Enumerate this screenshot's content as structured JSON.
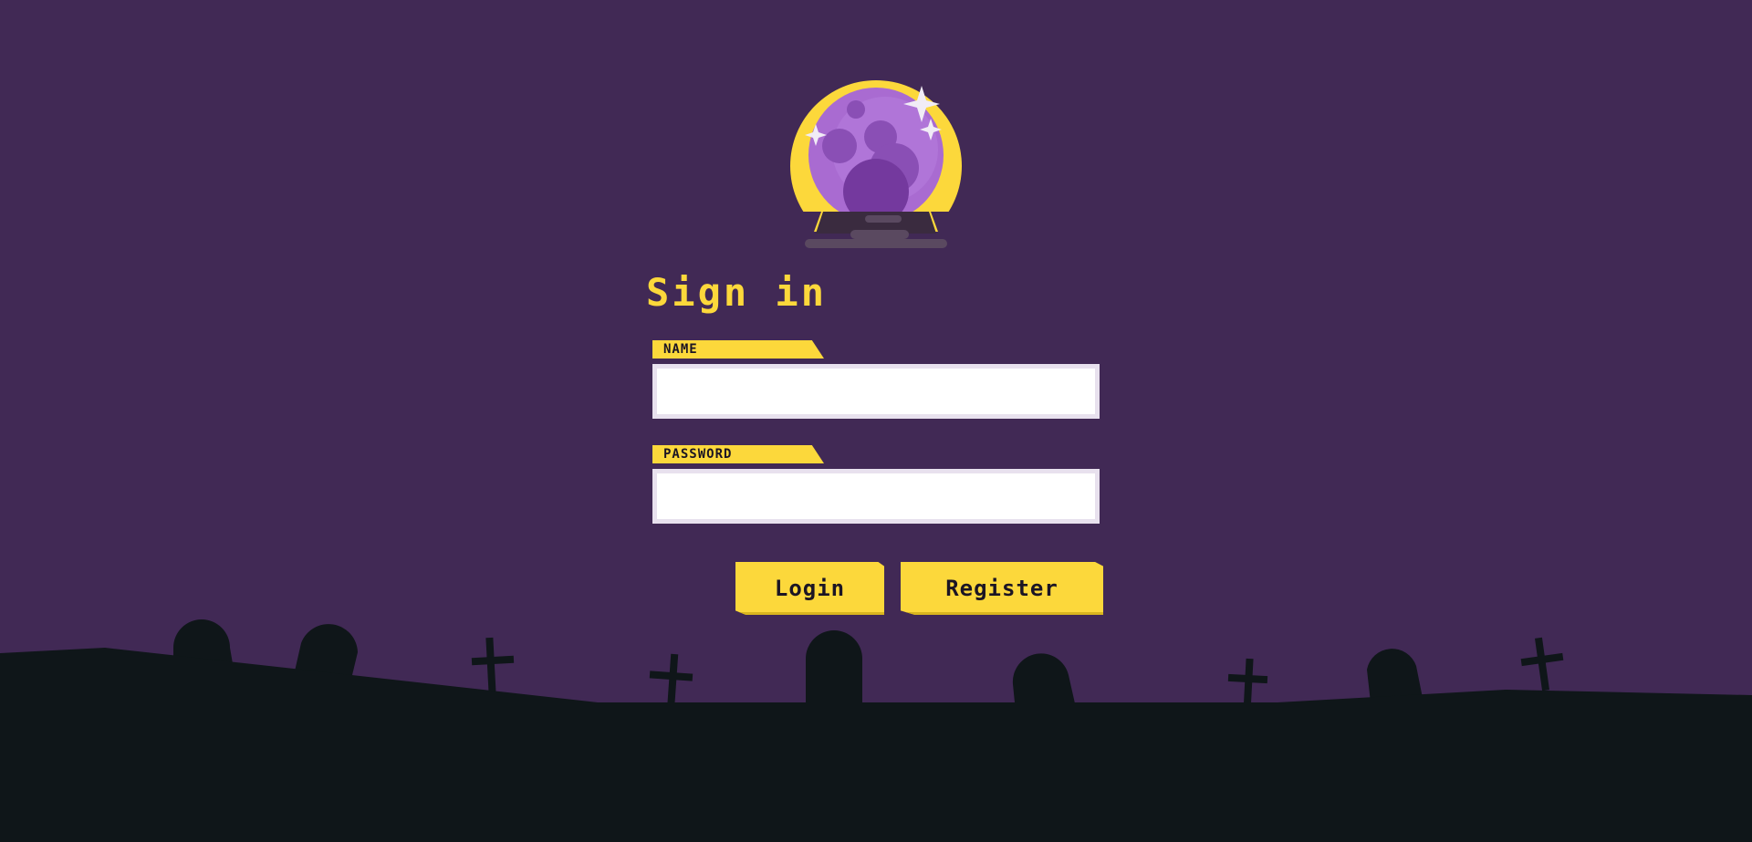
{
  "page": {
    "title": "Sign in"
  },
  "logo": {
    "icon": "crystal-ball-icon"
  },
  "form": {
    "name_label": "NAME",
    "name_value": "",
    "password_label": "PASSWORD",
    "password_value": ""
  },
  "buttons": {
    "login_label": "Login",
    "register_label": "Register"
  },
  "colors": {
    "background": "#412955",
    "accent": "#fcd83b",
    "ground": "#0f1619",
    "orb": "#a96bd1"
  }
}
